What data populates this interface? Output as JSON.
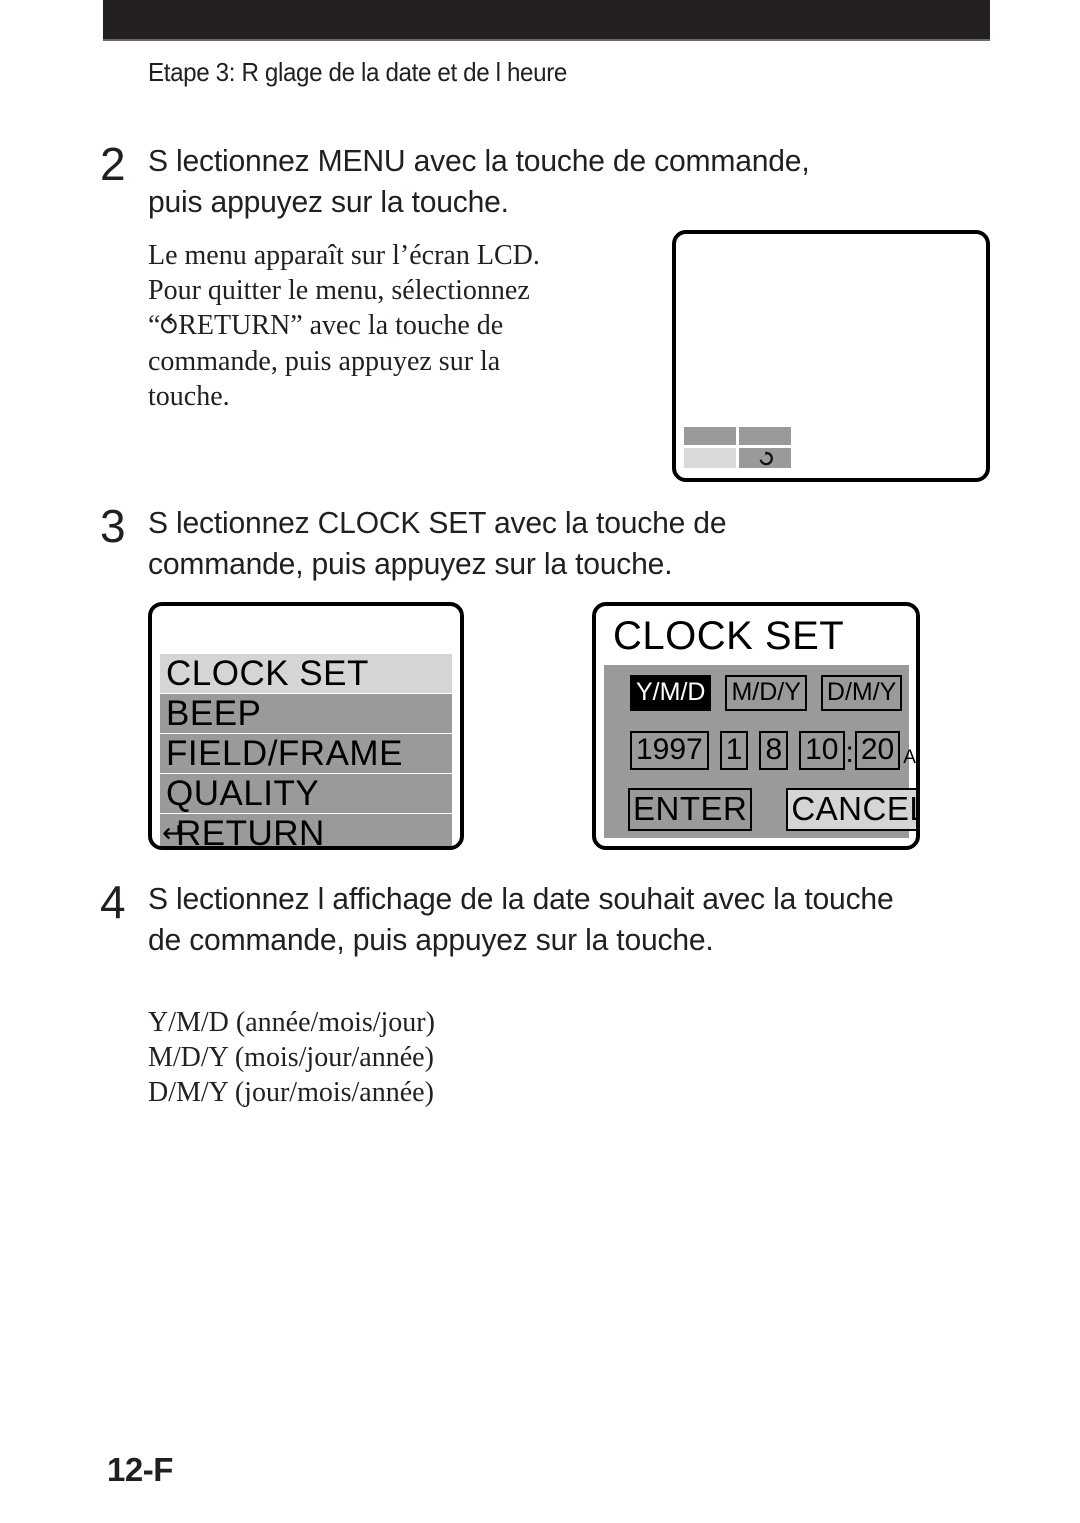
{
  "header": {
    "title": "Etape 3: R glage de la date et de l heure"
  },
  "steps": [
    {
      "number": "2",
      "text": "S lectionnez  MENU  avec la touche de commande, puis appuyez sur la touche."
    },
    {
      "number": "3",
      "text": "S lectionnez  CLOCK SET  avec la touche de commande, puis appuyez sur la touche."
    },
    {
      "number": "4",
      "text": "S lectionnez l affichage de la date souhait  avec la touche de commande, puis appuyez sur la touche."
    }
  ],
  "note_step2": {
    "line1": "Le menu apparaît sur l’écran LCD.",
    "line2": "Pour quitter le menu, sélectionnez",
    "line3_prefix": "“",
    "line3_icon": "return-arrow-icon",
    "line3_suffix": "RETURN” avec la touche de",
    "line4": "commande, puis appuyez sur la",
    "line5": "touche."
  },
  "lcd_blank": {
    "name": "blank-lcd-screen",
    "tiles": [
      {
        "shade": "dark",
        "icon": ""
      },
      {
        "shade": "dark",
        "icon": ""
      },
      {
        "shade": "light",
        "icon": ""
      },
      {
        "shade": "dark",
        "icon": "return-arrow-icon"
      }
    ]
  },
  "lcd_menu": {
    "items": [
      {
        "label": "CLOCK SET",
        "selected": true,
        "icon": ""
      },
      {
        "label": "BEEP",
        "selected": false,
        "icon": ""
      },
      {
        "label": "FIELD/FRAME",
        "selected": false,
        "icon": ""
      },
      {
        "label": "QUALITY",
        "selected": false,
        "icon": ""
      },
      {
        "label": "RETURN",
        "selected": false,
        "icon": "return-arrow-icon"
      }
    ]
  },
  "lcd_clock": {
    "title": "CLOCK SET",
    "formats": [
      {
        "label": "Y/M/D",
        "selected": true
      },
      {
        "label": "M/D/Y",
        "selected": false
      },
      {
        "label": "D/M/Y",
        "selected": false
      }
    ],
    "date": {
      "year": "1997",
      "month": "1",
      "day": "8",
      "hour": "10",
      "separator": ":",
      "minute": "20",
      "meridiem": "AM"
    },
    "buttons": [
      {
        "label": "ENTER",
        "filled": false
      },
      {
        "label": "CANCEL",
        "filled": true
      }
    ]
  },
  "date_legend": [
    "Y/M/D (année/mois/jour)",
    "M/D/Y  (mois/jour/année)",
    "D/M/Y (jour/mois/année)"
  ],
  "page_number": "12-F",
  "colors": {
    "ink": "#231f20",
    "menu_row": "#9a9a9a",
    "menu_row_selected": "#d5d5d5",
    "panel": "#9a9a9a",
    "tile_light": "#d9d9d9"
  }
}
